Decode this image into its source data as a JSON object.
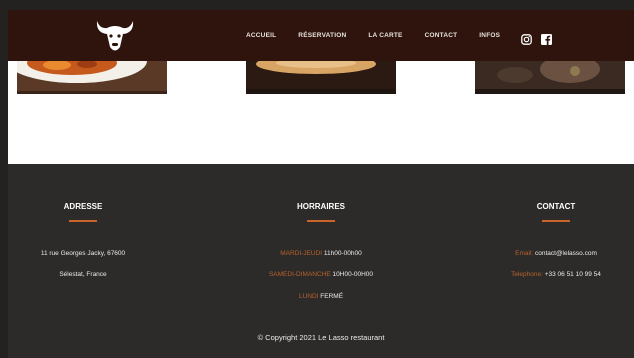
{
  "header": {
    "nav": [
      "ACCUEIL",
      "RÉSERVATION",
      "LA CARTE",
      "CONTACT",
      "INFOS"
    ],
    "social": [
      "instagram-icon",
      "facebook-icon"
    ]
  },
  "colors": {
    "header_bg": "#2e140d",
    "footer_bg": "#2c2b2a",
    "accent": "#c9642a"
  },
  "footer": {
    "adresse": {
      "title": "ADRESSE",
      "line1": "11 rue Georges Jacky, 67600",
      "line2": "Sélestat, France"
    },
    "horaires": {
      "title": "HORRAIRES",
      "rows": [
        {
          "label": "MARDI-JEUDI",
          "value": "11h00-00h00"
        },
        {
          "label": "SAMEDI-DIMANCHE",
          "value": "10H00-00H00"
        },
        {
          "label": "LUNDI",
          "value": "FERMÉ"
        }
      ]
    },
    "contact": {
      "title": "CONTACT",
      "rows": [
        {
          "label": "Email:",
          "value": "contact@lelasso.com"
        },
        {
          "label": "Telephone:",
          "value": "+33 06 51 10 99 54"
        }
      ]
    },
    "copyright": "© Copyright 2021 Le Lasso restaurant"
  }
}
